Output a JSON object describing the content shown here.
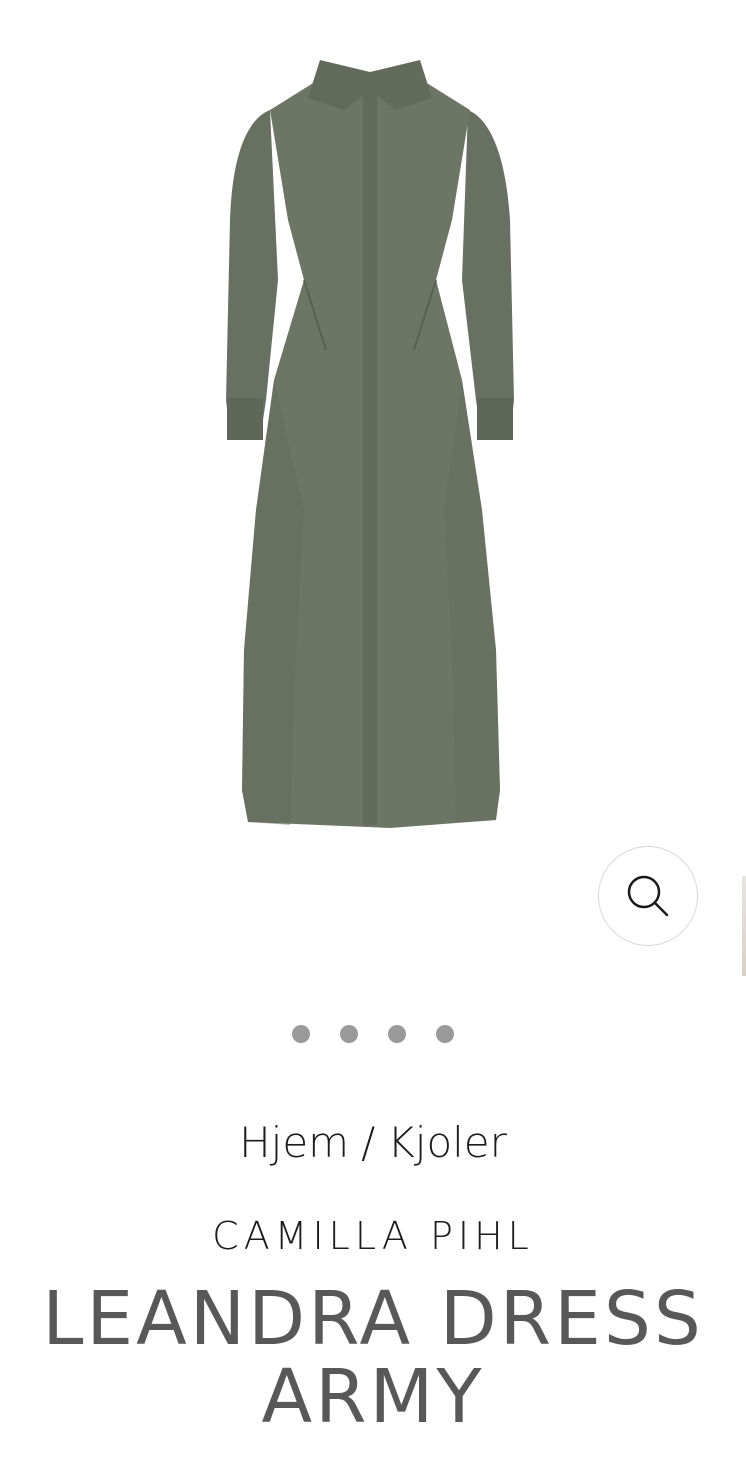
{
  "gallery": {
    "image_alt": "Leandra Dress Army",
    "dress_color": "#6b7060",
    "slide_count": 4,
    "active_slide": 1,
    "zoom_icon": "search-icon"
  },
  "breadcrumb": {
    "home": "Hjem",
    "separator": "/",
    "category": "Kjoler"
  },
  "product": {
    "brand": "CAMILLA PIHL",
    "title_line1": "LEANDRA DRESS",
    "title_line2": "ARMY"
  }
}
